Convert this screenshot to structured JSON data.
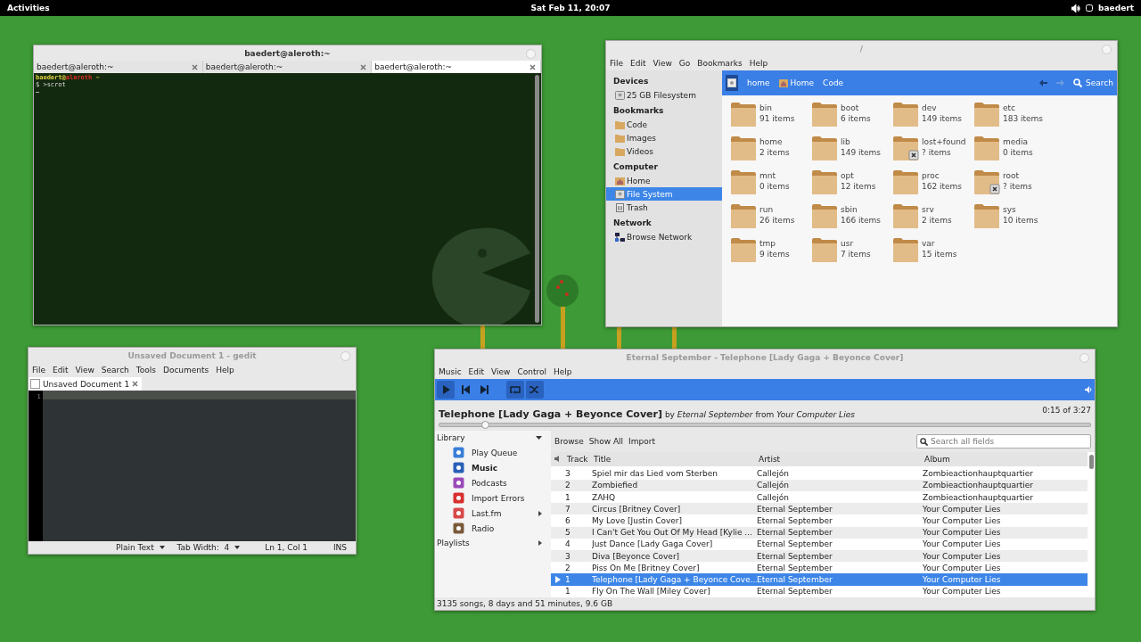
{
  "top_bar": {
    "activities": "Activities",
    "clock": "Sat Feb 11, 20:07",
    "user": "baedert"
  },
  "terminal": {
    "title": "baedert@aleroth:~",
    "tabs": [
      {
        "label": "baedert@aleroth:~",
        "selected": false
      },
      {
        "label": "baedert@aleroth:~",
        "selected": false
      },
      {
        "label": "baedert@aleroth:~",
        "selected": true
      }
    ],
    "prompt": {
      "user": "baedert",
      "at": "@",
      "host": "aleroth",
      "dir": "~"
    },
    "command": "$ >scrot"
  },
  "files": {
    "title": "/",
    "menu": [
      "File",
      "Edit",
      "View",
      "Go",
      "Bookmarks",
      "Help"
    ],
    "sidebar": [
      {
        "heading": "Devices",
        "items": [
          {
            "label": "25 GB Filesystem",
            "kind": "drive",
            "selected": false
          }
        ]
      },
      {
        "heading": "Bookmarks",
        "items": [
          {
            "label": "Code",
            "kind": "folder",
            "selected": false
          },
          {
            "label": "Images",
            "kind": "images",
            "selected": false
          },
          {
            "label": "Videos",
            "kind": "videos",
            "selected": false
          }
        ]
      },
      {
        "heading": "Computer",
        "items": [
          {
            "label": "Home",
            "kind": "home",
            "selected": false
          },
          {
            "label": "File System",
            "kind": "drive",
            "selected": true
          },
          {
            "label": "Trash",
            "kind": "trash",
            "selected": false
          }
        ]
      },
      {
        "heading": "Network",
        "items": [
          {
            "label": "Browse Network",
            "kind": "network",
            "selected": false
          }
        ]
      }
    ],
    "path": [
      {
        "label": "home",
        "kind": "plain"
      },
      {
        "label": "Home",
        "kind": "home"
      },
      {
        "label": "Code",
        "kind": "plain"
      }
    ],
    "search": "Search",
    "folders": [
      {
        "name": "bin",
        "count": "91 items",
        "locked": false
      },
      {
        "name": "boot",
        "count": "6 items",
        "locked": false
      },
      {
        "name": "dev",
        "count": "149 items",
        "locked": false
      },
      {
        "name": "etc",
        "count": "183 items",
        "locked": false
      },
      {
        "name": "home",
        "count": "2 items",
        "locked": false
      },
      {
        "name": "lib",
        "count": "149 items",
        "locked": false
      },
      {
        "name": "lost+found",
        "count": "? items",
        "locked": true
      },
      {
        "name": "media",
        "count": "0 items",
        "locked": false
      },
      {
        "name": "mnt",
        "count": "0 items",
        "locked": false
      },
      {
        "name": "opt",
        "count": "12 items",
        "locked": false
      },
      {
        "name": "proc",
        "count": "162 items",
        "locked": false
      },
      {
        "name": "root",
        "count": "? items",
        "locked": true
      },
      {
        "name": "run",
        "count": "26 items",
        "locked": false
      },
      {
        "name": "sbin",
        "count": "166 items",
        "locked": false
      },
      {
        "name": "srv",
        "count": "2 items",
        "locked": false
      },
      {
        "name": "sys",
        "count": "10 items",
        "locked": false
      },
      {
        "name": "tmp",
        "count": "9 items",
        "locked": false
      },
      {
        "name": "usr",
        "count": "7 items",
        "locked": false
      },
      {
        "name": "var",
        "count": "15 items",
        "locked": false
      }
    ]
  },
  "gedit": {
    "title": "Unsaved Document 1 - gedit",
    "menu": [
      "File",
      "Edit",
      "View",
      "Search",
      "Tools",
      "Documents",
      "Help"
    ],
    "tab": "Unsaved Document 1",
    "line_number": "1",
    "status": {
      "language": "Plain Text",
      "tab_width": "Tab Width:  4",
      "position": "Ln 1, Col 1",
      "mode": "INS"
    }
  },
  "player": {
    "title": "Eternal September - Telephone [Lady Gaga + Beyonce Cover]",
    "menu": [
      "Music",
      "Edit",
      "View",
      "Control",
      "Help"
    ],
    "controls": [
      {
        "kind": "play",
        "on": true
      },
      {
        "kind": "previous",
        "on": false
      },
      {
        "kind": "next",
        "on": false
      },
      {
        "kind": "repeat",
        "on": true
      },
      {
        "kind": "shuffle",
        "on": true
      }
    ],
    "now_playing": "**Telephone [Lady Gaga + Beyonce Cover]** by *Eternal September* from *Your Computer Lies*",
    "time": "0:15 of 3:27",
    "progress": {
      "level": 0.07
    },
    "library": "Library",
    "sources": [
      {
        "label": "Play Queue",
        "kind": "queue",
        "selected": false,
        "submenu": false
      },
      {
        "label": "Music",
        "kind": "music",
        "selected": true,
        "submenu": false
      },
      {
        "label": "Podcasts",
        "kind": "podcast",
        "selected": false,
        "submenu": false
      },
      {
        "label": "Import Errors",
        "kind": "error",
        "selected": false,
        "submenu": false
      },
      {
        "label": "Last.fm",
        "kind": "lastfm",
        "selected": false,
        "submenu": true
      },
      {
        "label": "Radio",
        "kind": "radio",
        "selected": false,
        "submenu": false
      }
    ],
    "playlists": "Playlists",
    "browse_bar": [
      "Browse",
      "Show All",
      "Import"
    ],
    "search": {
      "placeholder": "Search all fields"
    },
    "columns": [
      "Track",
      "Title",
      "Artist",
      "Album"
    ],
    "rows": [
      {
        "track": "3",
        "title": "Spiel mir das Lied vom Sterben",
        "artist": "Callejón",
        "album": "Zombieactionhauptquartier",
        "playing": false,
        "selected": false
      },
      {
        "track": "2",
        "title": "Zombiefied",
        "artist": "Callejón",
        "album": "Zombieactionhauptquartier",
        "playing": false,
        "selected": false
      },
      {
        "track": "1",
        "title": "ZAHQ",
        "artist": "Callejón",
        "album": "Zombieactionhauptquartier",
        "playing": false,
        "selected": false
      },
      {
        "track": "7",
        "title": "Circus [Britney Cover]",
        "artist": "Eternal September",
        "album": "Your Computer Lies",
        "playing": false,
        "selected": false
      },
      {
        "track": "6",
        "title": "My Love [Justin Cover]",
        "artist": "Eternal September",
        "album": "Your Computer Lies",
        "playing": false,
        "selected": false
      },
      {
        "track": "5",
        "title": "I Can't Get You Out Of My Head [Kylie ...",
        "artist": "Eternal September",
        "album": "Your Computer Lies",
        "playing": false,
        "selected": false
      },
      {
        "track": "4",
        "title": "Just Dance [Lady Gaga Cover]",
        "artist": "Eternal September",
        "album": "Your Computer Lies",
        "playing": false,
        "selected": false
      },
      {
        "track": "3",
        "title": "Diva [Beyonce Cover]",
        "artist": "Eternal September",
        "album": "Your Computer Lies",
        "playing": false,
        "selected": false
      },
      {
        "track": "2",
        "title": "Piss On Me [Britney Cover]",
        "artist": "Eternal September",
        "album": "Your Computer Lies",
        "playing": false,
        "selected": false
      },
      {
        "track": "1",
        "title": "Telephone [Lady Gaga + Beyonce Cove...",
        "artist": "Eternal September",
        "album": "Your Computer Lies",
        "playing": true,
        "selected": true
      },
      {
        "track": "1",
        "title": "Fly On The Wall [Miley Cover]",
        "artist": "Eternal September",
        "album": "Your Computer Lies",
        "playing": false,
        "selected": false
      }
    ],
    "status": "3135 songs, 8 days and 51 minutes, 9.6 GB"
  }
}
